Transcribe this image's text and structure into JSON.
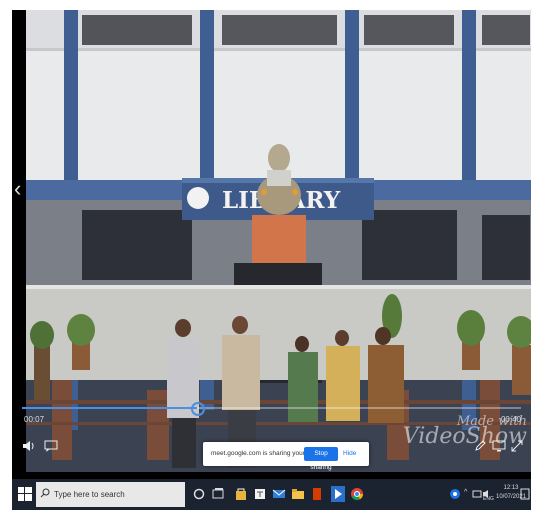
{
  "player": {
    "watermark_line1": "Made with",
    "watermark_line2": "VideoShow",
    "time_elapsed": "00:07",
    "time_total": "00:40",
    "progress_fraction": 0.35
  },
  "scene": {
    "building_sign": "LIBRARY"
  },
  "screen_share": {
    "message": "meet.google.com is sharing your screen.",
    "stop_label": "Stop sharing",
    "hide_label": "Hide"
  },
  "taskbar": {
    "search_placeholder": "Type here to search",
    "language": "ENG",
    "time": "12:13",
    "date": "10/07/2021",
    "icons": [
      "windows-start",
      "search",
      "task-view",
      "store",
      "teams",
      "mail",
      "file-explorer",
      "office",
      "cortana",
      "chrome"
    ],
    "colors": {
      "taskbar_bg": "#1b2230",
      "accent": "#1a73e8"
    }
  }
}
